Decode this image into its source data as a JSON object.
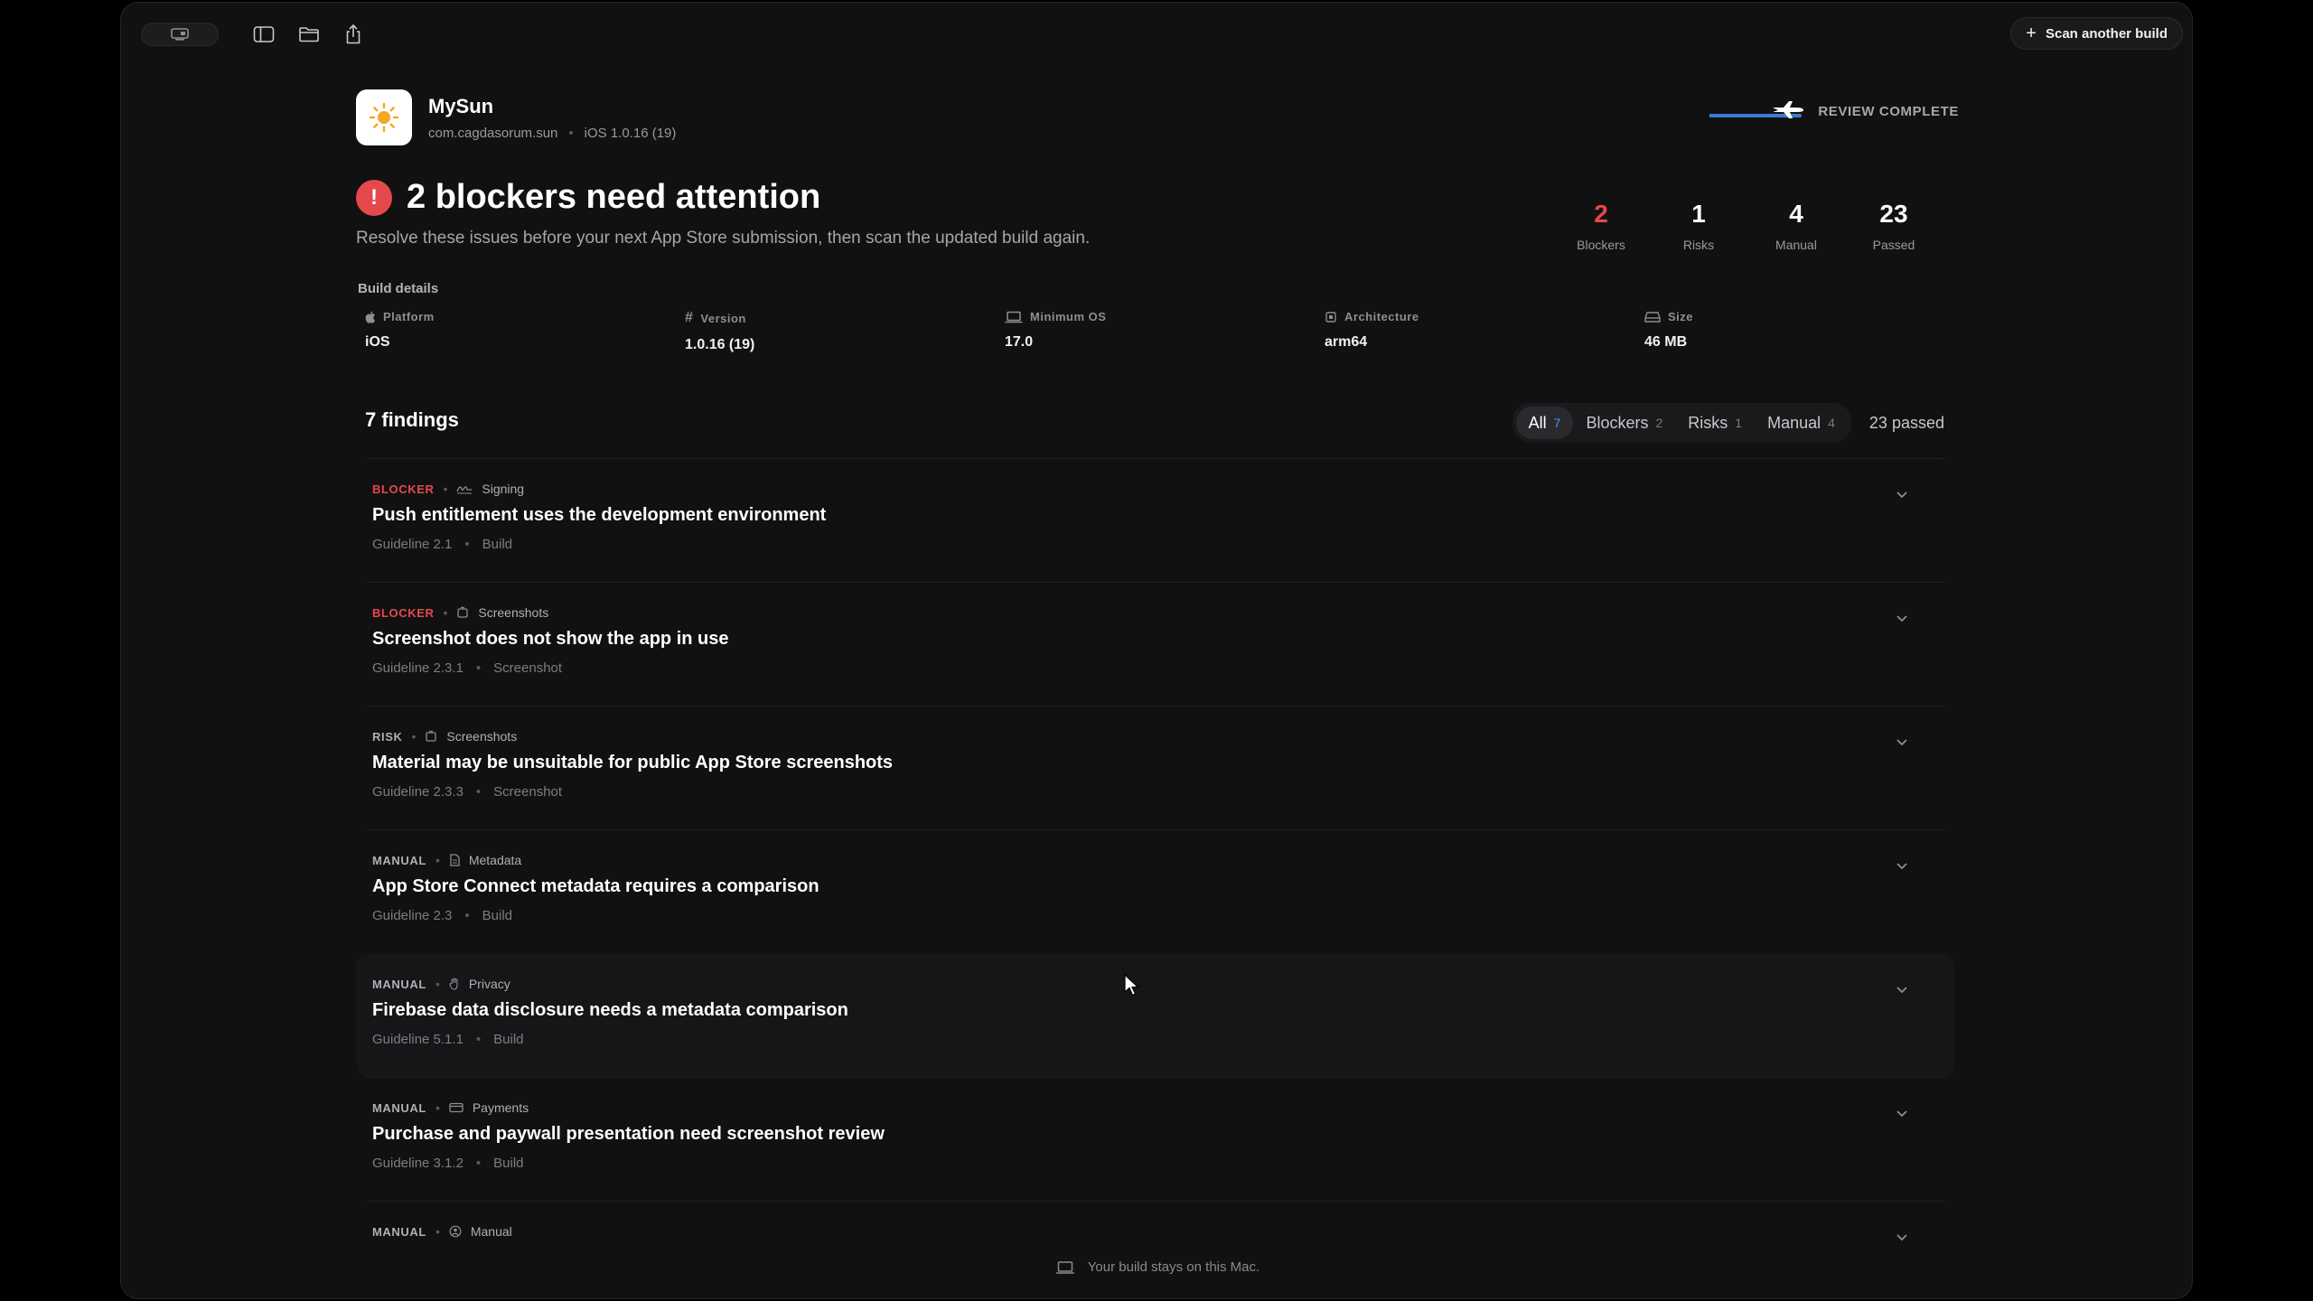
{
  "toolbar": {
    "scan_label": "Scan another build"
  },
  "app": {
    "name": "MySun",
    "bundle_id": "com.cagdasorum.sun",
    "platform_version": "iOS 1.0.16 (19)"
  },
  "review": {
    "status": "REVIEW COMPLETE"
  },
  "headline": {
    "title": "2 blockers need attention",
    "subtitle": "Resolve these issues before your next App Store submission, then scan the updated build again."
  },
  "stats": [
    {
      "value": "2",
      "label": "Blockers"
    },
    {
      "value": "1",
      "label": "Risks"
    },
    {
      "value": "4",
      "label": "Manual"
    },
    {
      "value": "23",
      "label": "Passed"
    }
  ],
  "build": {
    "title": "Build details",
    "items": [
      {
        "label": "Platform",
        "value": "iOS"
      },
      {
        "label": "Version",
        "value": "1.0.16 (19)"
      },
      {
        "label": "Minimum OS",
        "value": "17.0"
      },
      {
        "label": "Architecture",
        "value": "arm64"
      },
      {
        "label": "Size",
        "value": "46 MB"
      }
    ]
  },
  "findings": {
    "title": "7 findings",
    "filters": [
      {
        "label": "All",
        "count": "7"
      },
      {
        "label": "Blockers",
        "count": "2"
      },
      {
        "label": "Risks",
        "count": "1"
      },
      {
        "label": "Manual",
        "count": "4"
      }
    ],
    "passed": "23 passed",
    "items": [
      {
        "severity": "BLOCKER",
        "category": "Signing",
        "title": "Push entitlement uses the development environment",
        "guideline": "Guideline 2.1",
        "source": "Build"
      },
      {
        "severity": "BLOCKER",
        "category": "Screenshots",
        "title": "Screenshot does not show the app in use",
        "guideline": "Guideline 2.3.1",
        "source": "Screenshot"
      },
      {
        "severity": "RISK",
        "category": "Screenshots",
        "title": "Material may be unsuitable for public App Store screenshots",
        "guideline": "Guideline 2.3.3",
        "source": "Screenshot"
      },
      {
        "severity": "MANUAL",
        "category": "Metadata",
        "title": "App Store Connect metadata requires a comparison",
        "guideline": "Guideline 2.3",
        "source": "Build"
      },
      {
        "severity": "MANUAL",
        "category": "Privacy",
        "title": "Firebase data disclosure needs a metadata comparison",
        "guideline": "Guideline 5.1.1",
        "source": "Build"
      },
      {
        "severity": "MANUAL",
        "category": "Payments",
        "title": "Purchase and paywall presentation need screenshot review",
        "guideline": "Guideline 3.1.2",
        "source": "Build"
      },
      {
        "severity": "MANUAL",
        "category": "Manual"
      }
    ]
  },
  "footer": {
    "text": "Your build stays on this Mac."
  },
  "colors": {
    "accent": "#4a8ef0",
    "blocker": "#e5484d"
  }
}
